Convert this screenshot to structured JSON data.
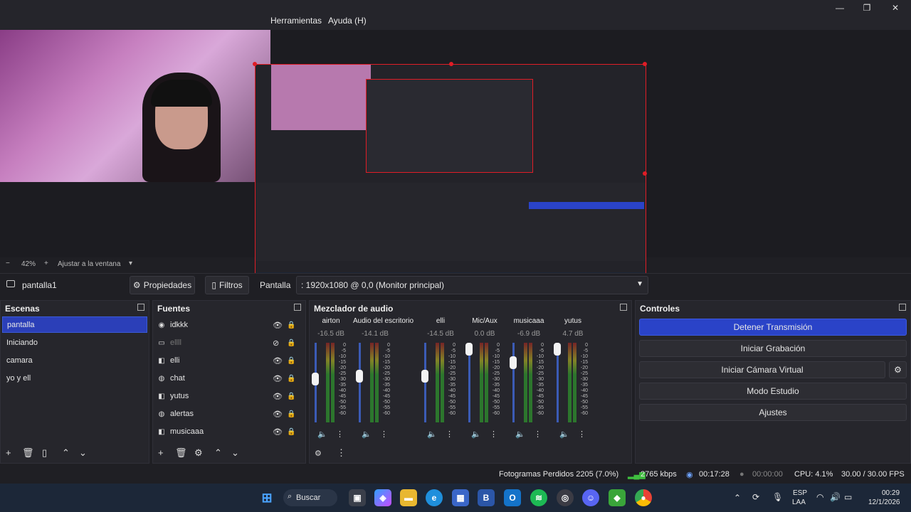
{
  "menu": {
    "tools": "Herramientas",
    "help": "Ayuda (H)"
  },
  "window_controls": {
    "minimize": "—",
    "maximize": "❐",
    "close": "✕"
  },
  "zoom": {
    "minus": "−",
    "value": "42%",
    "plus": "+",
    "fit": "Ajustar a la ventana",
    "dropdown": "▾"
  },
  "propbar": {
    "source_name": "pantalla1",
    "properties": "Propiedades",
    "filters": "Filtros",
    "display_label": "Pantalla",
    "display_value": ": 1920x1080 @ 0,0 (Monitor principal)"
  },
  "scenes": {
    "title": "Escenas",
    "items": [
      "pantalla",
      "Iniciando",
      "camara",
      "yo y ell"
    ]
  },
  "sources": {
    "title": "Fuentes",
    "items": [
      "idkkk",
      "ellll",
      "elli",
      "chat",
      "yutus",
      "alertas",
      "musicaaa"
    ]
  },
  "mixer": {
    "title": "Mezclador de audio",
    "channels": [
      {
        "name": "airton",
        "db": "-16.5 dB",
        "level": 0.55
      },
      {
        "name": "Audio del escritorio",
        "db": "-14.1 dB",
        "level": 0.6
      },
      {
        "name": "elli",
        "db": "-14.5 dB",
        "level": 0.6
      },
      {
        "name": "Mic/Aux",
        "db": "0.0 dB",
        "level": 1.0
      },
      {
        "name": "musicaaa",
        "db": "-6.9 dB",
        "level": 0.8
      },
      {
        "name": "yutus",
        "db": "4.7 dB",
        "level": 1.0
      }
    ],
    "scale": [
      "0",
      "-5",
      "-10",
      "-15",
      "-20",
      "-25",
      "-30",
      "-35",
      "-40",
      "-45",
      "-50",
      "-55",
      "-60"
    ]
  },
  "controls": {
    "title": "Controles",
    "stop_stream": "Detener Transmisión",
    "start_recording": "Iniciar Grabación",
    "start_virtual_cam": "Iniciar Cámara Virtual",
    "studio_mode": "Modo Estudio",
    "settings": "Ajustes"
  },
  "status": {
    "dropped_frames": "Fotogramas Perdidos 2205 (7.0%)",
    "bitrate": "2765 kbps",
    "stream_time": "00:17:28",
    "rec_time": "00:00:00",
    "cpu": "CPU: 4.1%",
    "fps": "30.00 / 30.00 FPS"
  },
  "taskbar": {
    "search": "Buscar",
    "lang_top": "ESP",
    "lang_bottom": "LAA",
    "time": "00:29",
    "date": "12/1/2026"
  },
  "colors": {
    "accent": "#2a43c8",
    "selection_red": "#e01d26"
  }
}
